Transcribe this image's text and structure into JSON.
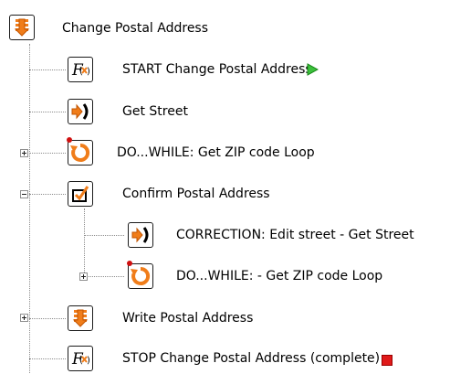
{
  "tree": {
    "root": {
      "label": "Change Postal Address",
      "icon": "process-icon"
    },
    "items": [
      {
        "label": "START Change Postal Address",
        "icon": "function-icon",
        "status": "start-arrow-icon"
      },
      {
        "label": "Get Street",
        "icon": "get-input-icon"
      },
      {
        "label": "DO...WHILE: Get ZIP code Loop",
        "icon": "loop-icon",
        "expander": "+"
      },
      {
        "label": "Confirm Postal Address",
        "icon": "confirm-icon",
        "expander": "-",
        "children": [
          {
            "label": "CORRECTION: Edit street - Get Street",
            "icon": "get-input-icon"
          },
          {
            "label": "DO...WHILE: - Get ZIP code Loop",
            "icon": "loop-icon",
            "expander": "+"
          }
        ]
      },
      {
        "label": "Write Postal Address",
        "icon": "process-icon",
        "expander": "+"
      },
      {
        "label": "STOP Change Postal Address (complete)",
        "icon": "function-icon",
        "status": "stop-square-icon"
      }
    ]
  },
  "colors": {
    "orange": "#f07d1a",
    "start_green": "#3cc03c",
    "stop_red": "#e01a1a",
    "connector": "#8c8c8c"
  }
}
